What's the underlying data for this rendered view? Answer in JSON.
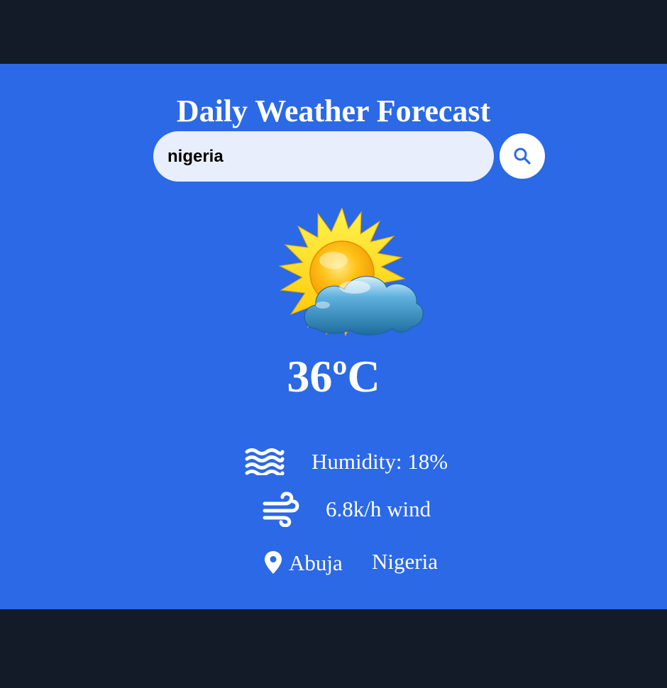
{
  "header": {
    "title": "Daily Weather Forecast"
  },
  "search": {
    "value": "nigeria",
    "button_icon": "search-icon"
  },
  "weather": {
    "icon": "sun-behind-cloud-icon",
    "temperature": "36ºC",
    "humidity_text": "Humidity: 18%",
    "humidity_icon": "water-waves-icon",
    "wind_text": "6.8k/h wind",
    "wind_icon": "wind-icon"
  },
  "location": {
    "icon": "location-pin-icon",
    "city": "Abuja",
    "country": "Nigeria"
  },
  "colors": {
    "background": "#131a28",
    "card": "#2b69e6",
    "input_bg": "#e8eefb",
    "accent": "#2b69e6",
    "text": "#ffffff"
  }
}
